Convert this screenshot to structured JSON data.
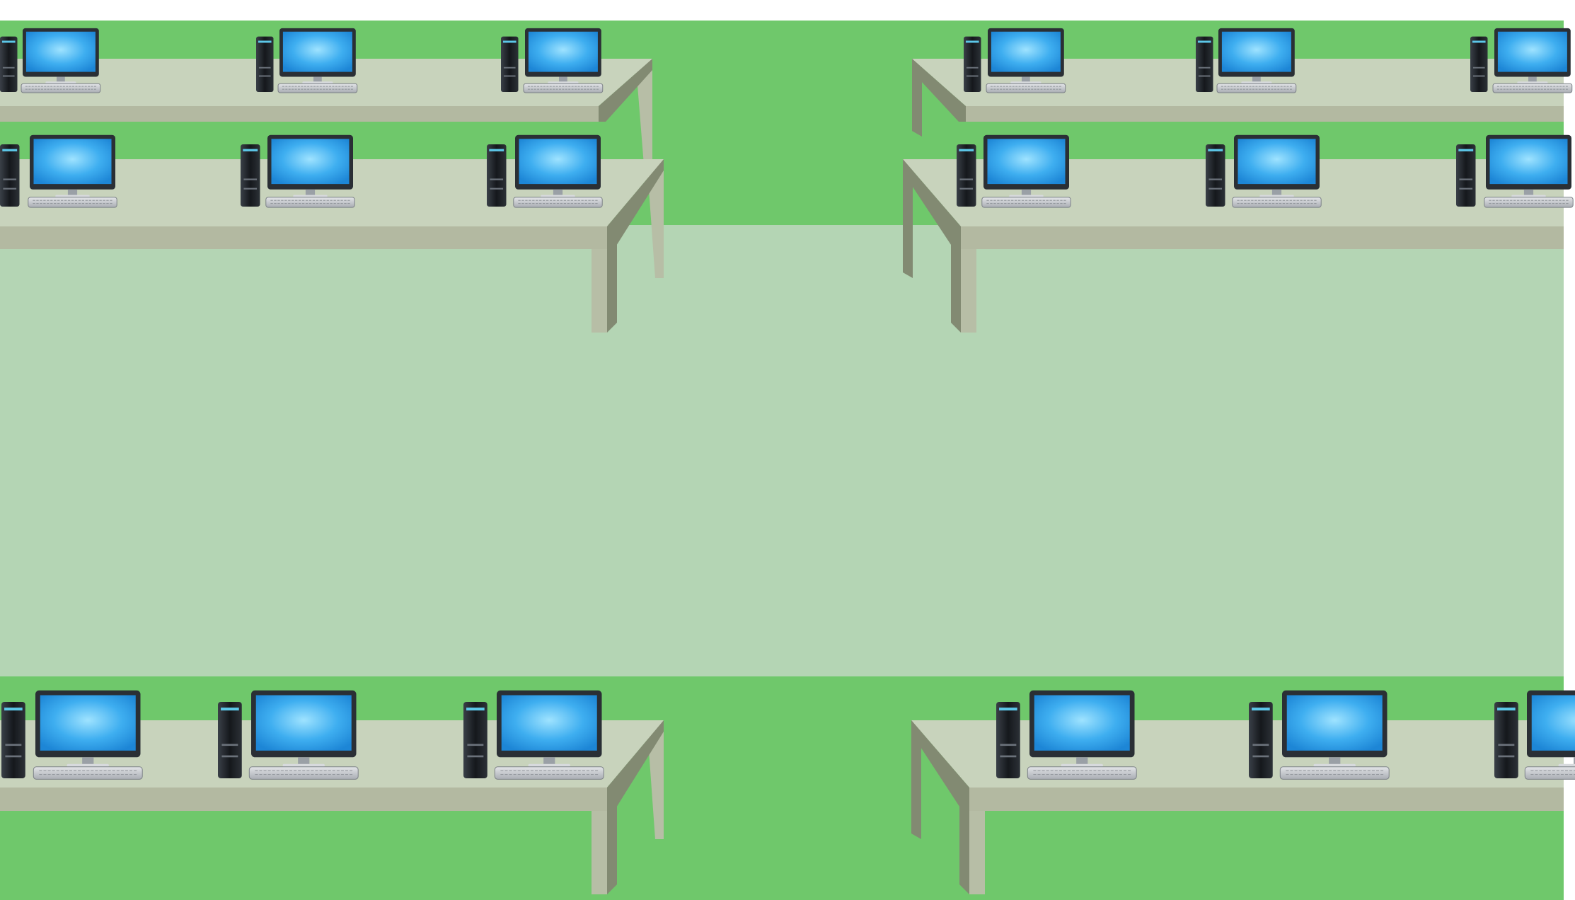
{
  "scene": {
    "title": "",
    "palette": {
      "page": "#ffffff",
      "floor_dark": "#6fc86b",
      "floor_light": "#b4d5b4",
      "desk_top": "#c8d3bc",
      "desk_front": "#b3b9a1",
      "desk_leg_front": "#b7bea6",
      "desk_leg_side": "#828a72",
      "monitor_bezel": "#2a2f35",
      "screen_light": "#9fe3ff",
      "screen_dark": "#1d86d6",
      "tower": "#22262b",
      "tower_accent": "#5cc7e8",
      "keyboard": "#c9ccd1"
    },
    "desk_groups": [
      {
        "name": "top-left-back",
        "workstations": 3
      },
      {
        "name": "top-left-front",
        "workstations": 3
      },
      {
        "name": "top-right-back",
        "workstations": 3
      },
      {
        "name": "top-right-front",
        "workstations": 3
      },
      {
        "name": "bottom-left",
        "workstations": 3
      },
      {
        "name": "bottom-right",
        "workstations": 3
      }
    ],
    "workstation_parts": [
      "monitor",
      "tower",
      "keyboard"
    ]
  }
}
